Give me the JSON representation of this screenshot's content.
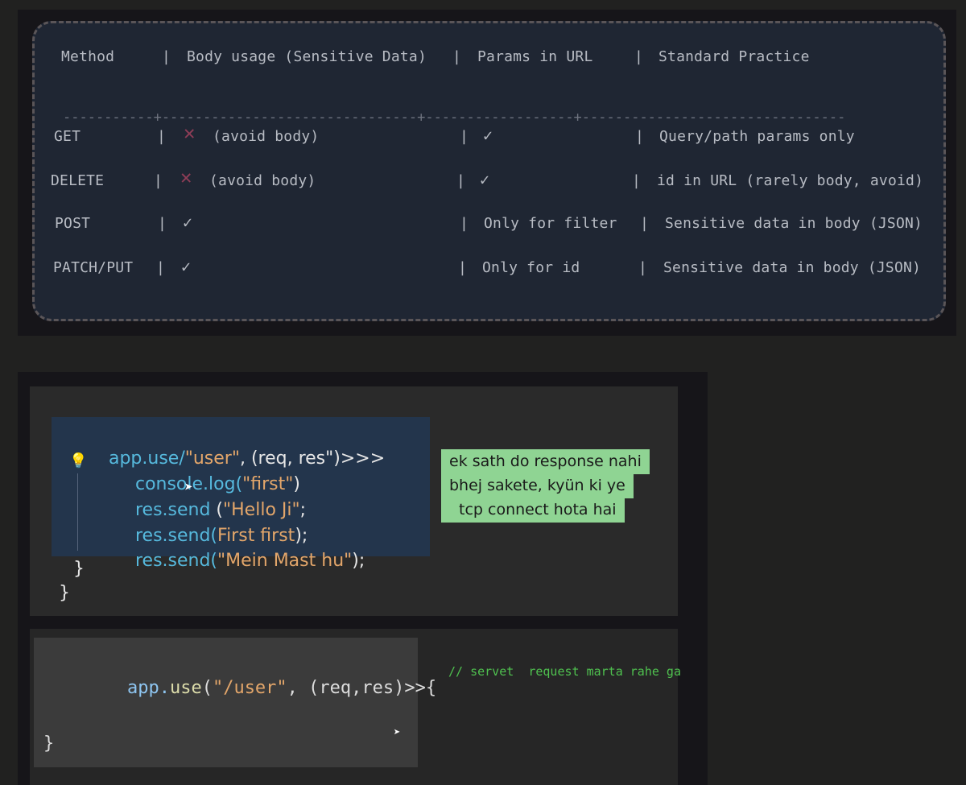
{
  "table": {
    "header": {
      "method": "Method",
      "body_usage": "Body usage (Sensitive Data)",
      "params_in_url": "Params in URL",
      "standard_practice": "Standard Practice"
    },
    "separator": "-----------+-------------------------------+------------------+--------------------------------",
    "pipe": "|",
    "rows": [
      {
        "method": "GET",
        "body_mark": "✕",
        "body_text": "(avoid body)",
        "params": "✓",
        "practice": "Query/path params only"
      },
      {
        "method": "DELETE",
        "body_mark": "✕",
        "body_text": "(avoid body)",
        "params": "✓",
        "practice": "id in URL (rarely body, avoid)"
      },
      {
        "method": "POST",
        "body_mark": "✓",
        "body_text": "",
        "params": "Only for filter",
        "practice": "Sensitive data in body (JSON)"
      },
      {
        "method": "PATCH/PUT",
        "body_mark": "✓",
        "body_text": "",
        "params": "Only for id",
        "practice": "Sensitive data in body (JSON)"
      }
    ]
  },
  "code1": {
    "line1_a": "app.use/",
    "line1_b": "\"user\"",
    "line1_c": ", (req, res\")>>>",
    "line2_a": "console.",
    "line2_b": "log(",
    "line2_c": "\"first\"",
    "line2_d": ")",
    "line3_a": "res.send",
    "line3_b": " (",
    "line3_c": "\"Hello Ji\"",
    "line3_d": ";",
    "line4_a": "res.send(",
    "line4_b": "First first",
    "line4_c": ");",
    "line5_a": "res.send(",
    "line5_b": "\"Mein Mast hu\"",
    "line5_c": ");",
    "close1": "}",
    "close2": "}",
    "bulb_icon": "lightbulb-icon",
    "cursor_icon": "mouse-pointer-icon"
  },
  "note": {
    "lines": [
      "ek sath do response nahi",
      "bhej sakete, kyün ki ye",
      "tcp connect hota hai"
    ]
  },
  "code2": {
    "part_app": "app.",
    "part_use": "use",
    "part_paren": "(",
    "part_str": "\"/user\"",
    "part_rest": ", (req,res)>>{",
    "close": "}",
    "comment": "// servet  request marta rahe ga",
    "cursor_icon": "mouse-pointer-icon"
  },
  "colors": {
    "background": "#212120",
    "table_bg": "#1f2633",
    "cross": "#8e3d57",
    "note_bg": "#8fd493",
    "comment": "#4fc14f",
    "keyword": "#56b9dd",
    "string": "#e3a66a"
  }
}
